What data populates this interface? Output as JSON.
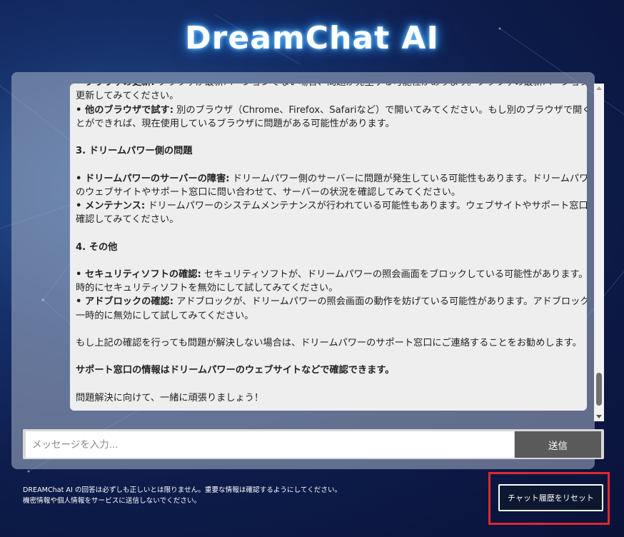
{
  "app": {
    "title": "DreamChat AI"
  },
  "chat": {
    "messages": [
      {
        "type": "line",
        "bold": "• ブラウザの更新:",
        "text": " ブラウザが最新バージョンでない場合、問題が発生する可能性があります。ブラウザの最新バージョンに"
      },
      {
        "type": "line",
        "bold": "",
        "text": "更新してみてください。"
      },
      {
        "type": "line",
        "bold": "• 他のブラウザで試す:",
        "text": " 別のブラウザ（Chrome、Firefox、Safariなど）で開いてみてください。もし別のブラウザで開くこ"
      },
      {
        "type": "line",
        "bold": "",
        "text": "とができれば、現在使用しているブラウザに問題がある可能性があります。"
      },
      {
        "type": "gap"
      },
      {
        "type": "line",
        "bold": "3. ドリームパワー側の問題",
        "text": ""
      },
      {
        "type": "gap"
      },
      {
        "type": "line",
        "bold": "• ドリームパワーのサーバーの障害:",
        "text": " ドリームパワー側のサーバーに問題が発生している可能性もあります。ドリームパワー"
      },
      {
        "type": "line",
        "bold": "",
        "text": "のウェブサイトやサポート窓口に問い合わせて、サーバーの状況を確認してみてください。"
      },
      {
        "type": "line",
        "bold": "• メンテナンス:",
        "text": " ドリームパワーのシステムメンテナンスが行われている可能性もあります。ウェブサイトやサポート窓口で"
      },
      {
        "type": "line",
        "bold": "",
        "text": "確認してみてください。"
      },
      {
        "type": "gap"
      },
      {
        "type": "line",
        "bold": "4. その他",
        "text": ""
      },
      {
        "type": "gap"
      },
      {
        "type": "line",
        "bold": "• セキュリティソフトの確認:",
        "text": " セキュリティソフトが、ドリームパワーの照会画面をブロックしている可能性があります。一"
      },
      {
        "type": "line",
        "bold": "",
        "text": "時的にセキュリティソフトを無効にして試してみてください。"
      },
      {
        "type": "line",
        "bold": "• アドブロックの確認:",
        "text": " アドブロックが、ドリームパワーの照会画面の動作を妨げている可能性があります。アドブロックを"
      },
      {
        "type": "line",
        "bold": "",
        "text": "一時的に無効にして試してみてください。"
      },
      {
        "type": "gap"
      },
      {
        "type": "line",
        "bold": "",
        "text": "もし上記の確認を行っても問題が解決しない場合は、ドリームパワーのサポート窓口にご連絡することをお勧めします。"
      },
      {
        "type": "gap"
      },
      {
        "type": "line",
        "bold": "サポート窓口の情報はドリームパワーのウェブサイトなどで確認できます。",
        "text": ""
      },
      {
        "type": "gap"
      },
      {
        "type": "line",
        "bold": "",
        "text": "問題解決に向けて、一緒に頑張りましょう！"
      }
    ]
  },
  "input": {
    "placeholder": "メッセージを入力...",
    "value": ""
  },
  "send_button": {
    "label": "送信"
  },
  "footer": {
    "disclaimer_line1": "DREAMChat AI の回答は必ずしも正しいとは限りません。重要な情報は確認するようにしてください。",
    "disclaimer_line2": "機密情報や個人情報をサービスに送信しないでください。"
  },
  "reset_button": {
    "label": "チャット履歴をリセット"
  },
  "colors": {
    "accent_highlight": "#e0282e",
    "send_button_bg": "#5a5a5a",
    "reset_button_bg": "#0d1830"
  }
}
